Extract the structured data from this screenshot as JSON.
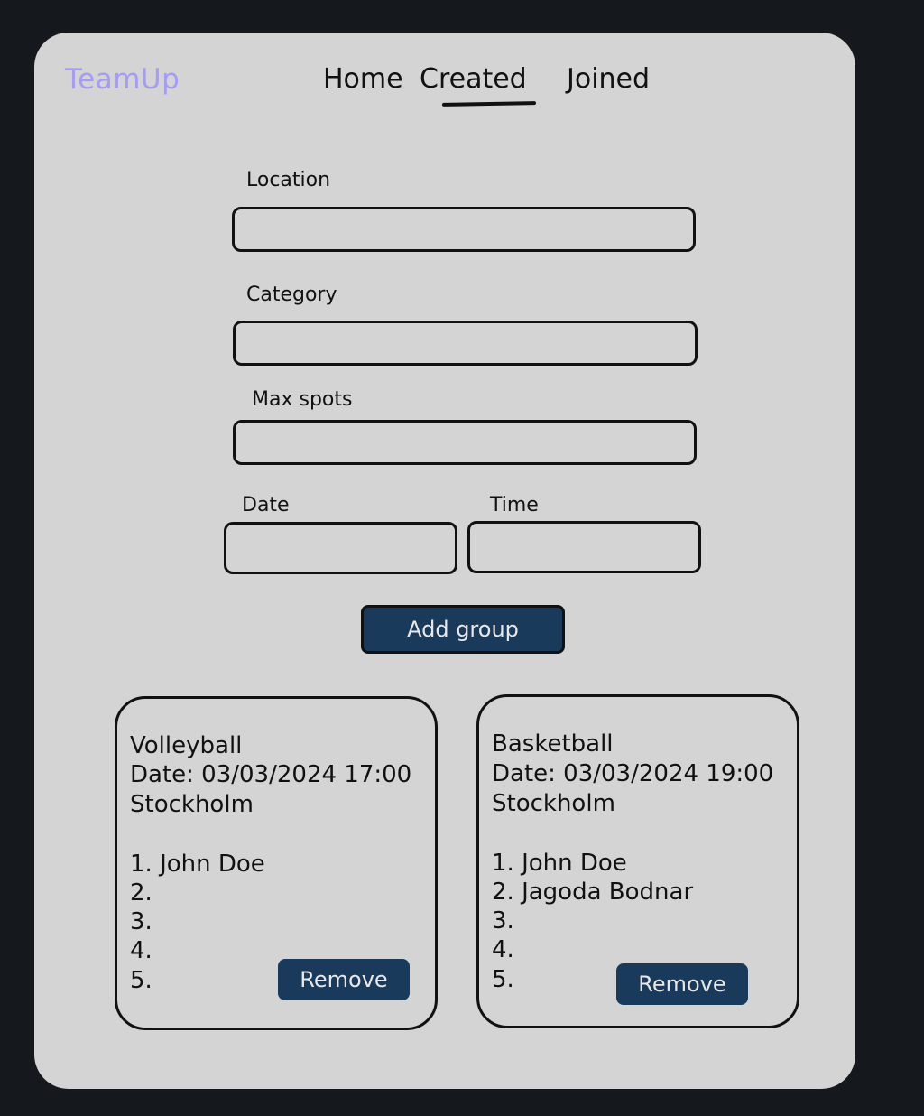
{
  "app": {
    "logo": "TeamUp"
  },
  "nav": {
    "home": "Home",
    "created": "Created",
    "joined": "Joined",
    "active": "created"
  },
  "form": {
    "location": {
      "label": "Location",
      "value": ""
    },
    "category": {
      "label": "Category",
      "value": ""
    },
    "max_spots": {
      "label": "Max spots",
      "value": ""
    },
    "date": {
      "label": "Date",
      "value": ""
    },
    "time": {
      "label": "Time",
      "value": ""
    },
    "submit_label": "Add group"
  },
  "groups": [
    {
      "category": "Volleyball",
      "datetime": "Date: 03/03/2024 17:00",
      "location": "Stockholm",
      "members": [
        "1. John Doe",
        "2.",
        "3.",
        "4.",
        "5."
      ],
      "remove_label": "Remove"
    },
    {
      "category": "Basketball",
      "datetime": "Date: 03/03/2024 19:00",
      "location": "Stockholm",
      "members": [
        "1. John Doe",
        "2. Jagoda Bodnar",
        "3.",
        "4.",
        "5."
      ],
      "remove_label": "Remove"
    }
  ],
  "colors": {
    "background": "#15191e",
    "panel": "#d4d4d4",
    "logo": "#a59cf4",
    "button": "#1a3a5c",
    "button_text": "#e8e8e8"
  }
}
